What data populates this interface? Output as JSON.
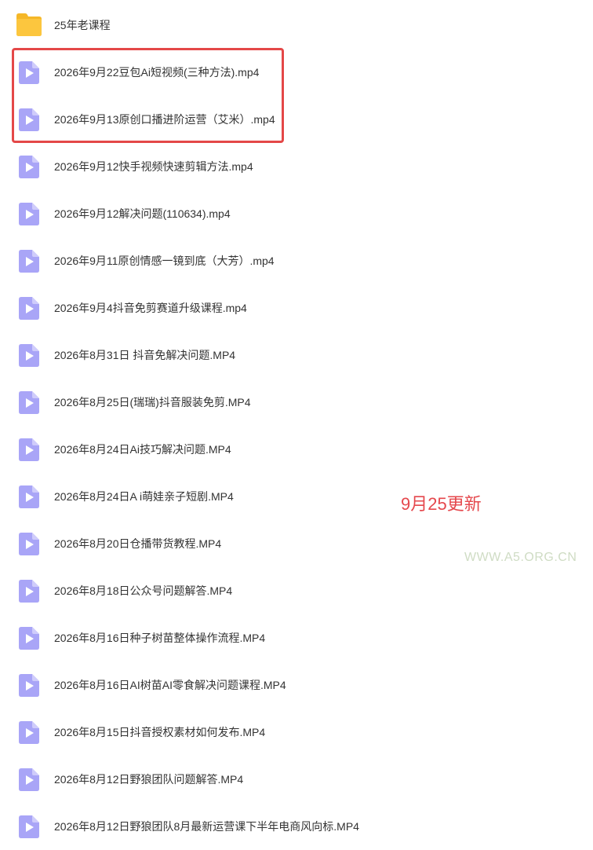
{
  "files": [
    {
      "name": "25年老课程",
      "type": "folder",
      "icon": "folder-icon"
    },
    {
      "name": "2026年9月22豆包Ai短视频(三种方法).mp4",
      "type": "video",
      "icon": "video-file-icon"
    },
    {
      "name": "2026年9月13原创口播进阶运营（艾米）.mp4",
      "type": "video",
      "icon": "video-file-icon"
    },
    {
      "name": "2026年9月12快手视频快速剪辑方法.mp4",
      "type": "video",
      "icon": "video-file-icon"
    },
    {
      "name": "2026年9月12解决问题(110634).mp4",
      "type": "video",
      "icon": "video-file-icon"
    },
    {
      "name": "2026年9月11原创情感一镜到底（大芳）.mp4",
      "type": "video",
      "icon": "video-file-icon"
    },
    {
      "name": "2026年9月4抖音免剪赛道升级课程.mp4",
      "type": "video",
      "icon": "video-file-icon"
    },
    {
      "name": "2026年8月31日 抖音免解决问题.MP4",
      "type": "video",
      "icon": "video-file-icon"
    },
    {
      "name": "2026年8月25日(瑞瑞)抖音服装免剪.MP4",
      "type": "video",
      "icon": "video-file-icon"
    },
    {
      "name": "2026年8月24日Ai技巧解决问题.MP4",
      "type": "video",
      "icon": "video-file-icon"
    },
    {
      "name": "2026年8月24日A i萌娃亲子短剧.MP4",
      "type": "video",
      "icon": "video-file-icon"
    },
    {
      "name": "2026年8月20日仓播带货教程.MP4",
      "type": "video",
      "icon": "video-file-icon"
    },
    {
      "name": "2026年8月18日公众号问题解答.MP4",
      "type": "video",
      "icon": "video-file-icon"
    },
    {
      "name": "2026年8月16日种子树苗整体操作流程.MP4",
      "type": "video",
      "icon": "video-file-icon"
    },
    {
      "name": "2026年8月16日AI树苗AI零食解决问题课程.MP4",
      "type": "video",
      "icon": "video-file-icon"
    },
    {
      "name": "2026年8月15日抖音授权素材如何发布.MP4",
      "type": "video",
      "icon": "video-file-icon"
    },
    {
      "name": "2026年8月12日野狼团队问题解答.MP4",
      "type": "video",
      "icon": "video-file-icon"
    },
    {
      "name": "2026年8月12日野狼团队8月最新运营课下半年电商风向标.MP4",
      "type": "video",
      "icon": "video-file-icon"
    }
  ],
  "annotation": {
    "update_note": "9月25更新",
    "watermark": "WWW.A5.ORG.CN"
  },
  "colors": {
    "folder": "#f9c13a",
    "video_icon": "#a9a5f7",
    "highlight_border": "#e44848",
    "update_note": "#e5484d",
    "watermark": "#cfdcc4",
    "text": "#333333"
  }
}
